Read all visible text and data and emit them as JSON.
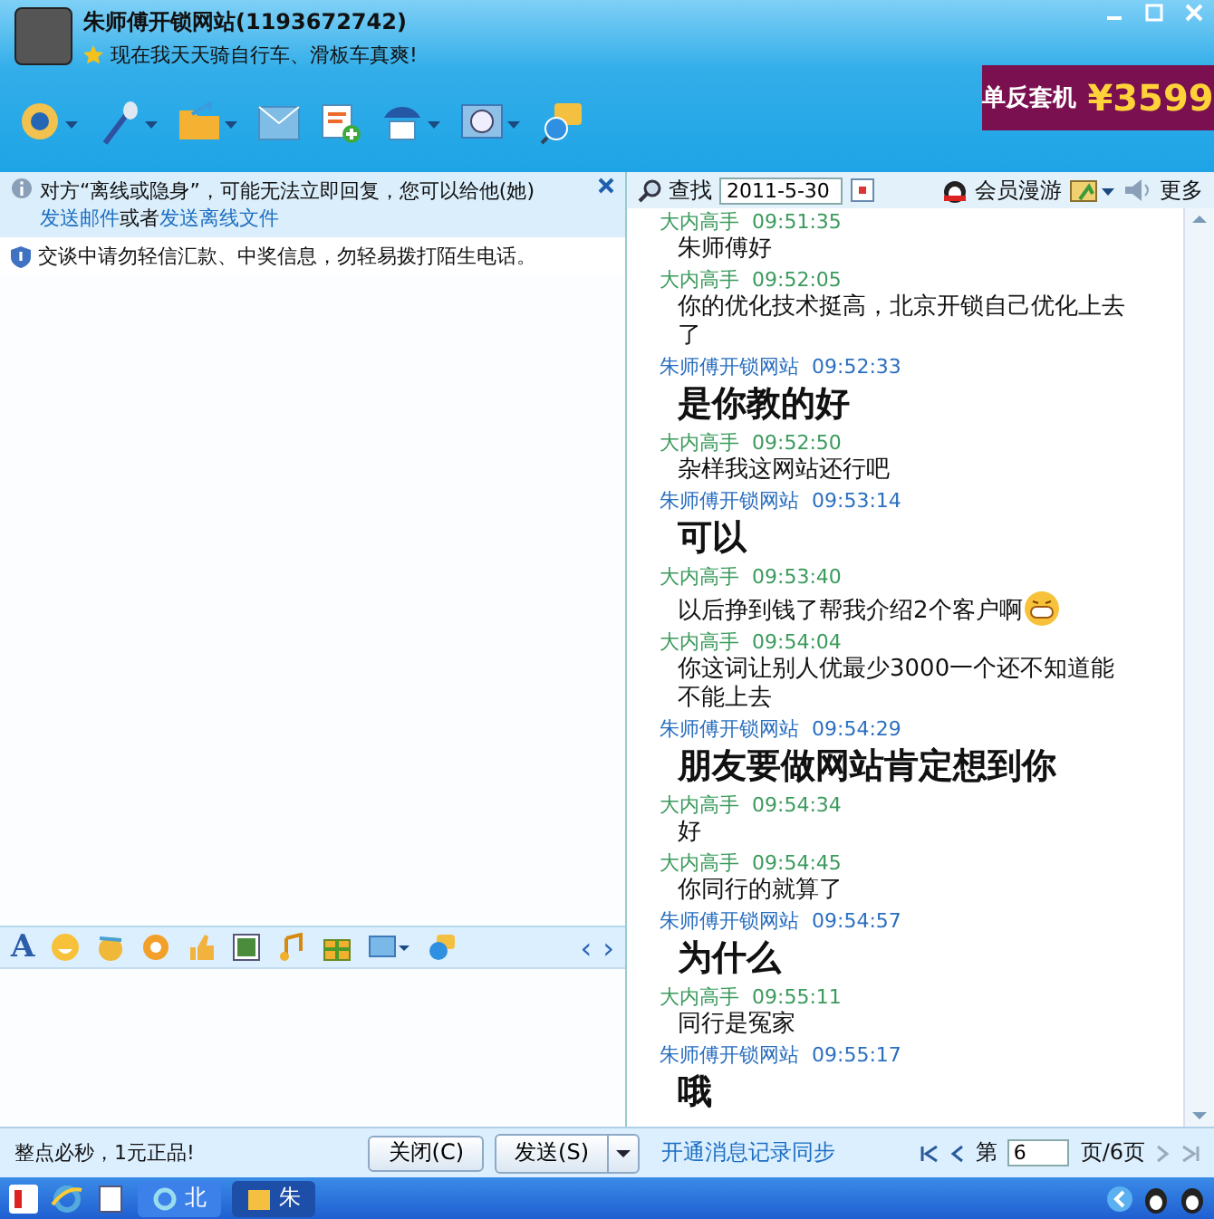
{
  "window": {
    "contact_name": "朱师傅开锁网站(1193672742)",
    "status_message": "现在我天天骑自行车、滑板车真爽!"
  },
  "ad": {
    "label": "单反套机",
    "price": "¥3599"
  },
  "notices": {
    "offline_before": "对方“离线或隐身”，可能无法立即回复，您可以给他(她)",
    "offline_link_1": "发送邮件",
    "offline_middle": "或者",
    "offline_link_2": "发送离线文件",
    "security": "交谈中请勿轻信汇款、中奖信息，勿轻易拨打陌生电话。"
  },
  "input_toolbar": {
    "font_button": "A",
    "prev": "‹",
    "next": "›"
  },
  "bottom_left": {
    "slogan": "整点必秒，1元正品!",
    "close_button": "关闭(C)",
    "send_button": "发送(S)"
  },
  "history_header": {
    "search_label": "查找",
    "date": "2011-5-30",
    "roaming": "会员漫游",
    "more": "更多"
  },
  "messages": [
    {
      "sender": "大内高手",
      "time": "09:51:35",
      "text": "朱师傅好",
      "kind": "received"
    },
    {
      "sender": "大内高手",
      "time": "09:52:05",
      "text": "你的优化技术挺高，北京开锁自己优化上去了",
      "kind": "received"
    },
    {
      "sender": "朱师傅开锁网站",
      "time": "09:52:33",
      "text": "是你教的好",
      "kind": "sent"
    },
    {
      "sender": "大内高手",
      "time": "09:52:50",
      "text": "杂样我这网站还行吧",
      "kind": "received"
    },
    {
      "sender": "朱师傅开锁网站",
      "time": "09:53:14",
      "text": "可以",
      "kind": "sent"
    },
    {
      "sender": "大内高手",
      "time": "09:53:40",
      "text": "以后挣到钱了帮我介绍2个客户啊",
      "kind": "received",
      "emoticon": true
    },
    {
      "sender": "大内高手",
      "time": "09:54:04",
      "text": "你这词让别人优最少3000一个还不知道能不能上去",
      "kind": "received"
    },
    {
      "sender": "朱师傅开锁网站",
      "time": "09:54:29",
      "text": "朋友要做网站肯定想到你",
      "kind": "sent"
    },
    {
      "sender": "大内高手",
      "time": "09:54:34",
      "text": "好",
      "kind": "received"
    },
    {
      "sender": "大内高手",
      "time": "09:54:45",
      "text": "你同行的就算了",
      "kind": "received"
    },
    {
      "sender": "朱师傅开锁网站",
      "time": "09:54:57",
      "text": "为什么",
      "kind": "sent"
    },
    {
      "sender": "大内高手",
      "time": "09:55:11",
      "text": "同行是冤家",
      "kind": "received"
    },
    {
      "sender": "朱师傅开锁网站",
      "time": "09:55:17",
      "text": "哦",
      "kind": "sent"
    }
  ],
  "history_footer": {
    "sync_link": "开通消息记录同步",
    "page_prefix": "第",
    "page": "6",
    "page_suffix": "页/6页"
  },
  "taskbar": {
    "tasks": [
      {
        "label": "北",
        "selected": false
      },
      {
        "label": "朱",
        "selected": true
      }
    ]
  }
}
